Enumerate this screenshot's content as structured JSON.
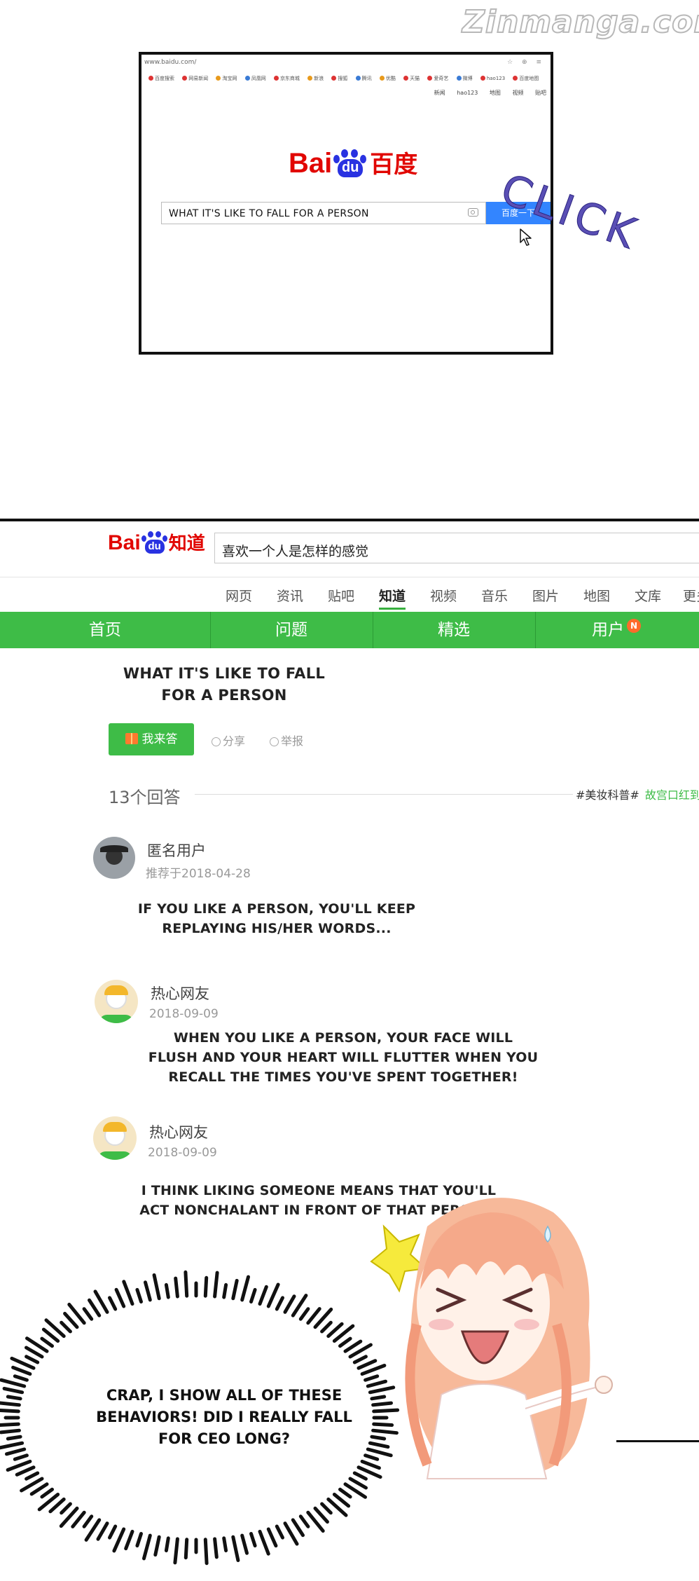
{
  "watermark": "Zinmanga.com",
  "browser": {
    "url": "www.baidu.com/",
    "tools": "☆ ⊕ ≡",
    "bookmarks": [
      "百度搜索",
      "网易新闻",
      "淘宝网",
      "凤凰网",
      "京东商城",
      "新浪",
      "搜狐",
      "腾讯",
      "优酷",
      "天猫",
      "爱奇艺",
      "微博",
      "hao123",
      "百度地图"
    ],
    "topnav": [
      "新闻",
      "hao123",
      "地图",
      "视频",
      "贴吧"
    ],
    "logo_left": "Bai",
    "logo_paw": "du",
    "logo_right": "百度",
    "search_value": "WHAT IT'S LIKE TO FALL FOR A PERSON",
    "search_button": "百度一下",
    "sfx": "CLICK"
  },
  "zhidao": {
    "logo_left": "Bai",
    "logo_paw": "du",
    "logo_right": "知道",
    "search_value": "喜欢一个人是怎样的感觉",
    "nav": [
      "网页",
      "资讯",
      "贴吧",
      "知道",
      "视频",
      "音乐",
      "图片",
      "地图",
      "文库",
      "更多"
    ],
    "active_nav": "知道",
    "tabs": [
      "首页",
      "问题",
      "精选",
      "用户"
    ],
    "user_badge": "N",
    "question_title_line1": "WHAT IT'S LIKE TO FALL",
    "question_title_line2": "FOR A PERSON",
    "answer_button": "我来答",
    "share": "分享",
    "report": "举报",
    "answer_count": "13个回答",
    "tag1": "#美妆科普#",
    "tag2": "故宫口红到",
    "answers": [
      {
        "user": "匿名用户",
        "date": "推荐于2018-04-28",
        "line1": "IF YOU LIKE A PERSON, YOU'LL KEEP",
        "line2": "REPLAYING HIS/HER WORDS...",
        "line3": ""
      },
      {
        "user": "热心网友",
        "date": "2018-09-09",
        "line1": "WHEN YOU LIKE A PERSON, YOUR FACE WILL",
        "line2": "FLUSH AND YOUR HEART WILL FLUTTER WHEN YOU",
        "line3": "RECALL THE TIMES YOU'VE SPENT TOGETHER!"
      },
      {
        "user": "热心网友",
        "date": "2018-09-09",
        "line1": "I THINK LIKING SOMEONE MEANS THAT YOU'LL",
        "line2": "ACT NONCHALANT IN FRONT OF THAT PERSON.",
        "line3": ""
      }
    ]
  },
  "speech": {
    "line1": "CRAP, I SHOW ALL OF THESE",
    "line2": "BEHAVIORS! DID I REALLY FALL",
    "line3": "FOR CEO LONG?"
  }
}
